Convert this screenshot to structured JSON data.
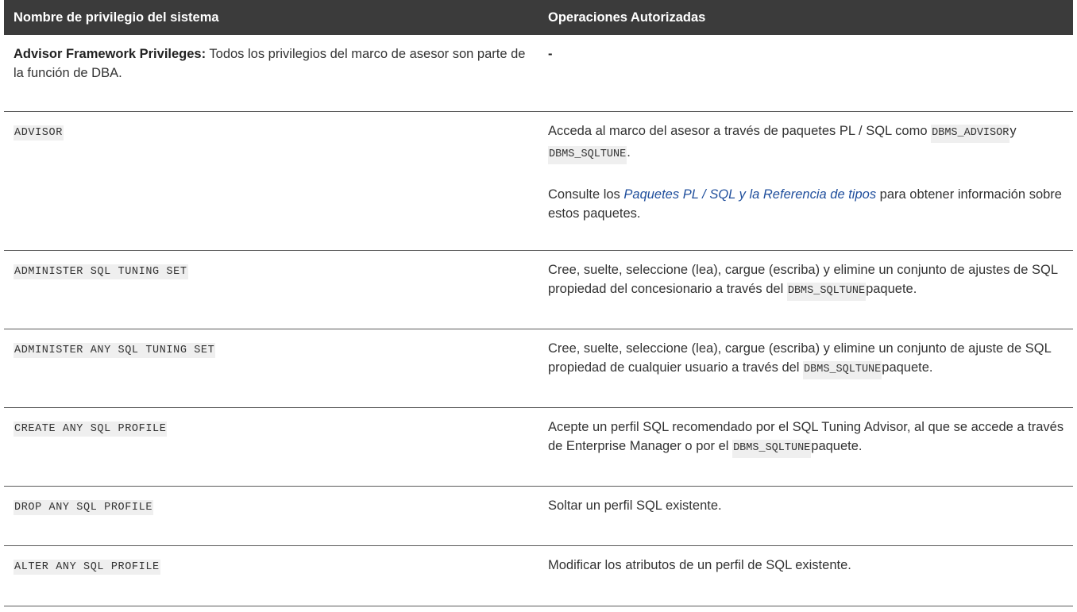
{
  "table": {
    "headers": {
      "privilege": "Nombre de privilegio del sistema",
      "operations": "Operaciones Autorizadas"
    },
    "intro_row": {
      "bold_label": "Advisor Framework Privileges:",
      "text": " Todos los privilegios del marco de asesor son parte de la función de DBA.",
      "operations": "-"
    },
    "rows": [
      {
        "privilege": "ADVISOR",
        "op_part1": "Acceda al marco del asesor a través de paquetes PL / SQL como ",
        "op_code1": "DBMS_ADVISOR",
        "op_part2": "y ",
        "op_code2": "DBMS_SQLTUNE",
        "op_part3": ".",
        "p2_part1": "Consulte los ",
        "p2_link": "Paquetes PL / SQL y la Referencia de tipos",
        "p2_part2": " para obtener información sobre estos paquetes."
      },
      {
        "privilege": "ADMINISTER SQL TUNING SET",
        "op_part1": "Cree, suelte, seleccione (lea), cargue (escriba) y elimine un conjunto de ajustes de SQL propiedad del concesionario a través del ",
        "op_code": "DBMS_SQLTUNE",
        "op_part2": "paquete."
      },
      {
        "privilege": "ADMINISTER ANY SQL TUNING SET",
        "op_part1": "Cree, suelte, seleccione (lea), cargue (escriba) y elimine un conjunto de ajuste de SQL propiedad de cualquier usuario a través del ",
        "op_code": "DBMS_SQLTUNE",
        "op_part2": "paquete."
      },
      {
        "privilege": "CREATE ANY SQL PROFILE",
        "op_part1": "Acepte un perfil SQL recomendado por el SQL Tuning Advisor, al que se accede a través de Enterprise Manager o por el ",
        "op_code": "DBMS_SQLTUNE",
        "op_part2": "paquete."
      },
      {
        "privilege": "DROP ANY SQL PROFILE",
        "op_text": "Soltar un perfil SQL existente."
      },
      {
        "privilege": "ALTER ANY SQL PROFILE",
        "op_text": "Modificar los atributos de un perfil de SQL existente."
      }
    ]
  },
  "colors": {
    "header_bg": "#3b3b3b",
    "header_text": "#ffffff",
    "link": "#1f4e9c",
    "code_bg": "#efefef",
    "row_border": "#5a5a5a"
  }
}
